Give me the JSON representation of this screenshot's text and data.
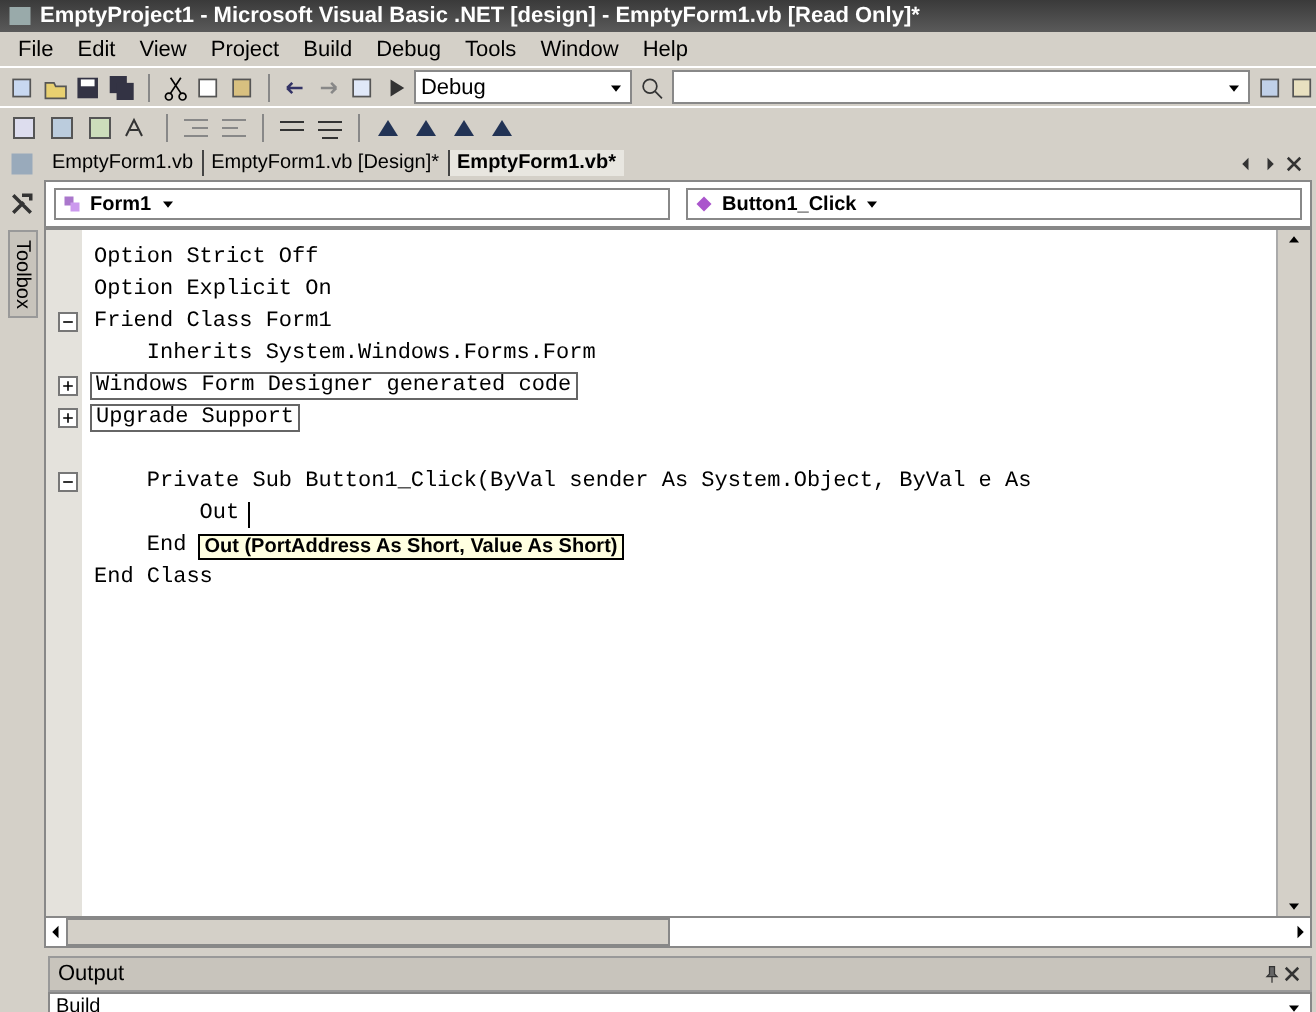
{
  "window": {
    "title": "EmptyProject1 - Microsoft Visual Basic .NET [design] - EmptyForm1.vb [Read Only]*"
  },
  "menu": [
    "File",
    "Edit",
    "View",
    "Project",
    "Build",
    "Debug",
    "Tools",
    "Window",
    "Help"
  ],
  "toolbar": {
    "configuration": "Debug"
  },
  "tabs": [
    {
      "label": "EmptyForm1.vb",
      "selected": false
    },
    {
      "label": "EmptyForm1.vb [Design]*",
      "selected": false
    },
    {
      "label": "EmptyForm1.vb*",
      "selected": true
    }
  ],
  "class_dropdown": "Form1",
  "method_dropdown": "Button1_Click",
  "toolbox": "Toolbox",
  "code": [
    {
      "text": "Option Strict Off"
    },
    {
      "text": "Option Explicit On"
    },
    {
      "expanded": true,
      "text": "Friend Class Form1"
    },
    {
      "text": "    Inherits System.Windows.Forms.Form"
    },
    {
      "expanded": false,
      "kind": "region",
      "text": "Windows Form Designer generated code"
    },
    {
      "expanded": false,
      "kind": "region",
      "text": "Upgrade Support"
    },
    {
      "kind": "blank"
    },
    {
      "expanded": true,
      "text": "    Private Sub Button1_Click(ByVal sender As System.Object, ByVal e As"
    },
    {
      "text": "        Out",
      "caret": true
    },
    {
      "text": "    End",
      "tooltip": "Out (PortAddress As Short, Value As Short)"
    },
    {
      "text": "End Class"
    }
  ],
  "output": {
    "title": "Output",
    "pane": "Build"
  }
}
